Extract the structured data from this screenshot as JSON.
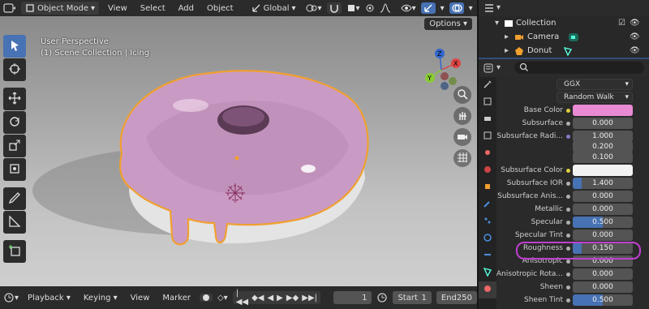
{
  "header": {
    "mode_label": "Object Mode",
    "menus": [
      "View",
      "Select",
      "Add",
      "Object"
    ],
    "orientation_label": "Global"
  },
  "viewport": {
    "perspective_label": "User Perspective",
    "collection_label": "(1) Scene Collection | Icing",
    "options_label": "Options",
    "gizmo_axes": {
      "x": "X",
      "y": "Y",
      "z": "Z"
    }
  },
  "timeline": {
    "playback_label": "Playback",
    "keying_label": "Keying",
    "view_label": "View",
    "marker_label": "Marker",
    "current_frame": "1",
    "start_label": "Start",
    "start_value": "1",
    "end_label": "End",
    "end_value": "250"
  },
  "outliner": {
    "items": [
      {
        "label": "Collection"
      },
      {
        "label": "Camera"
      },
      {
        "label": "Donut"
      }
    ]
  },
  "properties": {
    "distribution": "GGX",
    "subsurface_method": "Random Walk",
    "rows": [
      {
        "label": "Base Color",
        "kind": "color",
        "color": "#e98ad4"
      },
      {
        "label": "Subsurface",
        "kind": "value",
        "value": "0.000",
        "fill": 0
      },
      {
        "label": "Subsurface Radi...",
        "kind": "vector",
        "values": [
          "1.000",
          "0.200",
          "0.100"
        ]
      },
      {
        "label": "Subsurface Color",
        "kind": "color",
        "color": "#f2f2f2"
      },
      {
        "label": "Subsurface IOR",
        "kind": "value",
        "value": "1.400",
        "fill": 0.12
      },
      {
        "label": "Subsurface Anis...",
        "kind": "value",
        "value": "0.000",
        "fill": 0
      },
      {
        "label": "Metallic",
        "kind": "value",
        "value": "0.000",
        "fill": 0
      },
      {
        "label": "Specular",
        "kind": "value",
        "value": "0.500",
        "fill": 0.5
      },
      {
        "label": "Specular Tint",
        "kind": "value",
        "value": "0.000",
        "fill": 0
      },
      {
        "label": "Roughness",
        "kind": "value",
        "value": "0.150",
        "fill": 0.15,
        "highlight": true
      },
      {
        "label": "Anisotropic",
        "kind": "value",
        "value": "0.000",
        "fill": 0
      },
      {
        "label": "Anisotropic Rota...",
        "kind": "value",
        "value": "0.000",
        "fill": 0
      },
      {
        "label": "Sheen",
        "kind": "value",
        "value": "0.000",
        "fill": 0
      },
      {
        "label": "Sheen Tint",
        "kind": "value",
        "value": "0.500",
        "fill": 0.5
      }
    ]
  },
  "colors": {
    "accent": "#4772b3",
    "selection_outline": "#f0a030",
    "icing": "#cfa0c8",
    "highlight_ring": "#c040d0"
  }
}
